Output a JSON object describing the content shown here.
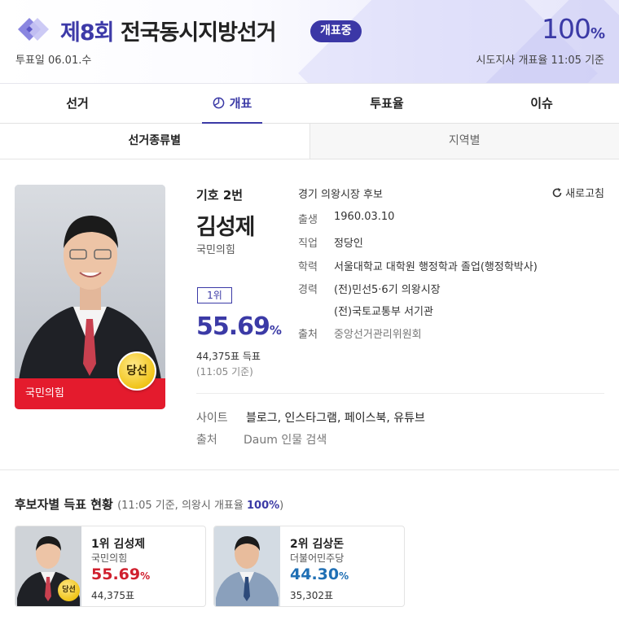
{
  "header": {
    "title_num": "제8회",
    "title_rest": " 전국동시지방선거",
    "badge": "개표중",
    "vote_day": "투표일 06.01.수",
    "overall_pct": "100",
    "overall_pct_unit": "%",
    "count_rate_text": "시도지사 개표율 11:05 기준"
  },
  "tabs": [
    {
      "label": "선거"
    },
    {
      "label": "개표",
      "icon": "pie-chart-icon"
    },
    {
      "label": "투표율"
    },
    {
      "label": "이슈"
    }
  ],
  "subtabs": [
    {
      "label": "선거종류별"
    },
    {
      "label": "지역별"
    }
  ],
  "candidate": {
    "number": "기호 2번",
    "name": "김성제",
    "party": "국민의힘",
    "party_bar": "국민의힘",
    "win_label": "당선",
    "rank": "1위",
    "pct": "55.69",
    "pct_unit": "%",
    "votes": "44,375표 득표",
    "as_of": "(11:05 기준)",
    "race": "경기 의왕시장 후보",
    "birth_k": "출생",
    "birth_v": "1960.03.10",
    "job_k": "직업",
    "job_v": "정당인",
    "edu_k": "학력",
    "edu_v": "서울대학교 대학원 행정학과 졸업(행정학박사)",
    "career_k": "경력",
    "career_v1": "(전)민선5·6기 의왕시장",
    "career_v2": "(전)국토교통부 서기관",
    "src_k": "출처",
    "src_v": "중앙선거관리위원회",
    "site_k": "사이트",
    "site_v": "블로그, 인스타그램, 페이스북, 유튜브",
    "src2_k": "출처",
    "src2_v": "Daum 인물 검색",
    "party_color": "#e41b2d"
  },
  "refresh_label": "새로고침",
  "section": {
    "title": "후보자별 득표 현황",
    "meta_pre": "(11:05 기준, 의왕시 개표율 ",
    "meta_pct": "100%",
    "meta_post": ")"
  },
  "candidates_list": [
    {
      "rank": "1위",
      "name": "김성제",
      "party": "국민의힘",
      "pct": "55.69",
      "pct_unit": "%",
      "votes": "44,375표",
      "win": "당선",
      "color": "#d0202e"
    },
    {
      "rank": "2위",
      "name": "김상돈",
      "party": "더불어민주당",
      "pct": "44.30",
      "pct_unit": "%",
      "votes": "35,302표",
      "color": "#1f6fb4"
    }
  ],
  "colors": {
    "accent": "#3b3aa6",
    "ppp_red": "#e41b2d",
    "dem_blue": "#1f6fb4"
  }
}
